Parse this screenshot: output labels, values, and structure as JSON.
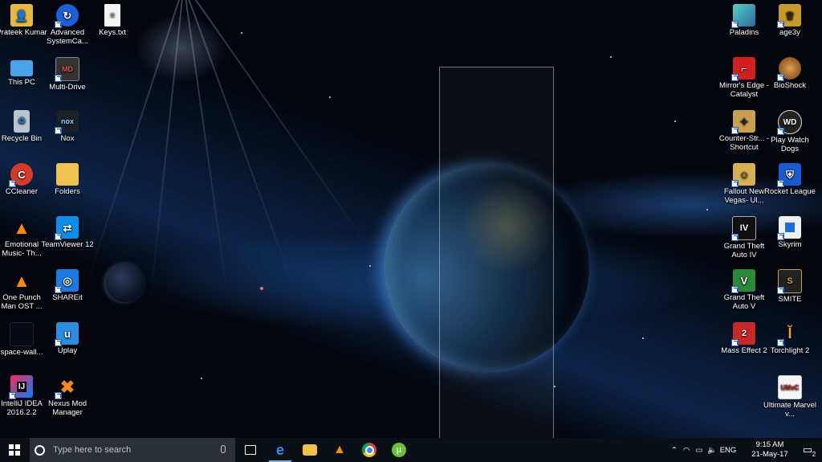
{
  "desktop": {
    "left_icons": [
      {
        "name": "Prateek Kumar",
        "icon": "user-folder-icon"
      },
      {
        "name": "Advanced SystemCa...",
        "icon": "advanced-systemcare-icon"
      },
      {
        "name": "Keys.txt",
        "icon": "text-file-icon"
      },
      {
        "name": "This PC",
        "icon": "this-pc-icon"
      },
      {
        "name": "Multi-Drive",
        "icon": "multi-drive-icon"
      },
      {
        "name": "Recycle Bin",
        "icon": "recycle-bin-icon"
      },
      {
        "name": "Nox",
        "icon": "nox-icon"
      },
      {
        "name": "CCleaner",
        "icon": "ccleaner-icon"
      },
      {
        "name": "Folders",
        "icon": "folder-icon"
      },
      {
        "name": "Emotional Music- Th...",
        "icon": "vlc-icon"
      },
      {
        "name": "TeamViewer 12",
        "icon": "teamviewer-icon"
      },
      {
        "name": "One Punch Man OST ...",
        "icon": "vlc-icon"
      },
      {
        "name": "SHAREit",
        "icon": "shareit-icon"
      },
      {
        "name": "space-wall...",
        "icon": "image-file-icon"
      },
      {
        "name": "Uplay",
        "icon": "uplay-icon"
      },
      {
        "name": "IntelliJ IDEA 2016.2.2",
        "icon": "intellij-icon"
      },
      {
        "name": "Nexus Mod Manager",
        "icon": "nexus-mod-manager-icon"
      }
    ],
    "right_icons": [
      {
        "name": "Paladins",
        "icon": "paladins-icon"
      },
      {
        "name": "age3y",
        "icon": "age3y-icon"
      },
      {
        "name": "Mirror's Edge - Catalyst",
        "icon": "mirrors-edge-icon"
      },
      {
        "name": "BioShock",
        "icon": "bioshock-icon"
      },
      {
        "name": "Counter-Str... - Shortcut",
        "icon": "counter-strike-icon"
      },
      {
        "name": "Play Watch Dogs",
        "icon": "watch-dogs-icon"
      },
      {
        "name": "Fallout New Vegas- Ul...",
        "icon": "fallout-icon"
      },
      {
        "name": "Rocket League",
        "icon": "rocket-league-icon"
      },
      {
        "name": "Grand Theft Auto IV",
        "icon": "gta4-icon"
      },
      {
        "name": "Skyrim",
        "icon": "skyrim-icon"
      },
      {
        "name": "Grand Theft Auto V",
        "icon": "gta5-icon"
      },
      {
        "name": "SMITE",
        "icon": "smite-icon"
      },
      {
        "name": "Mass Effect 2",
        "icon": "mass-effect-icon"
      },
      {
        "name": "Torchlight 2",
        "icon": "torchlight-icon"
      },
      {
        "name": "Ultimate Marvel v...",
        "icon": "marvel-icon"
      }
    ]
  },
  "taskbar": {
    "search_placeholder": "Type here to search",
    "pinned": [
      "task-view-icon",
      "edge-icon",
      "file-explorer-icon",
      "vlc-icon",
      "chrome-icon",
      "utorrent-icon"
    ],
    "tray": {
      "language": "ENG",
      "time": "9:15 AM",
      "date": "21-May-17",
      "notification_count": "2"
    }
  },
  "colors": {
    "taskbar_bg": "#0b0f16",
    "search_bg": "#2b2f36",
    "accent": "#76b9ed"
  }
}
